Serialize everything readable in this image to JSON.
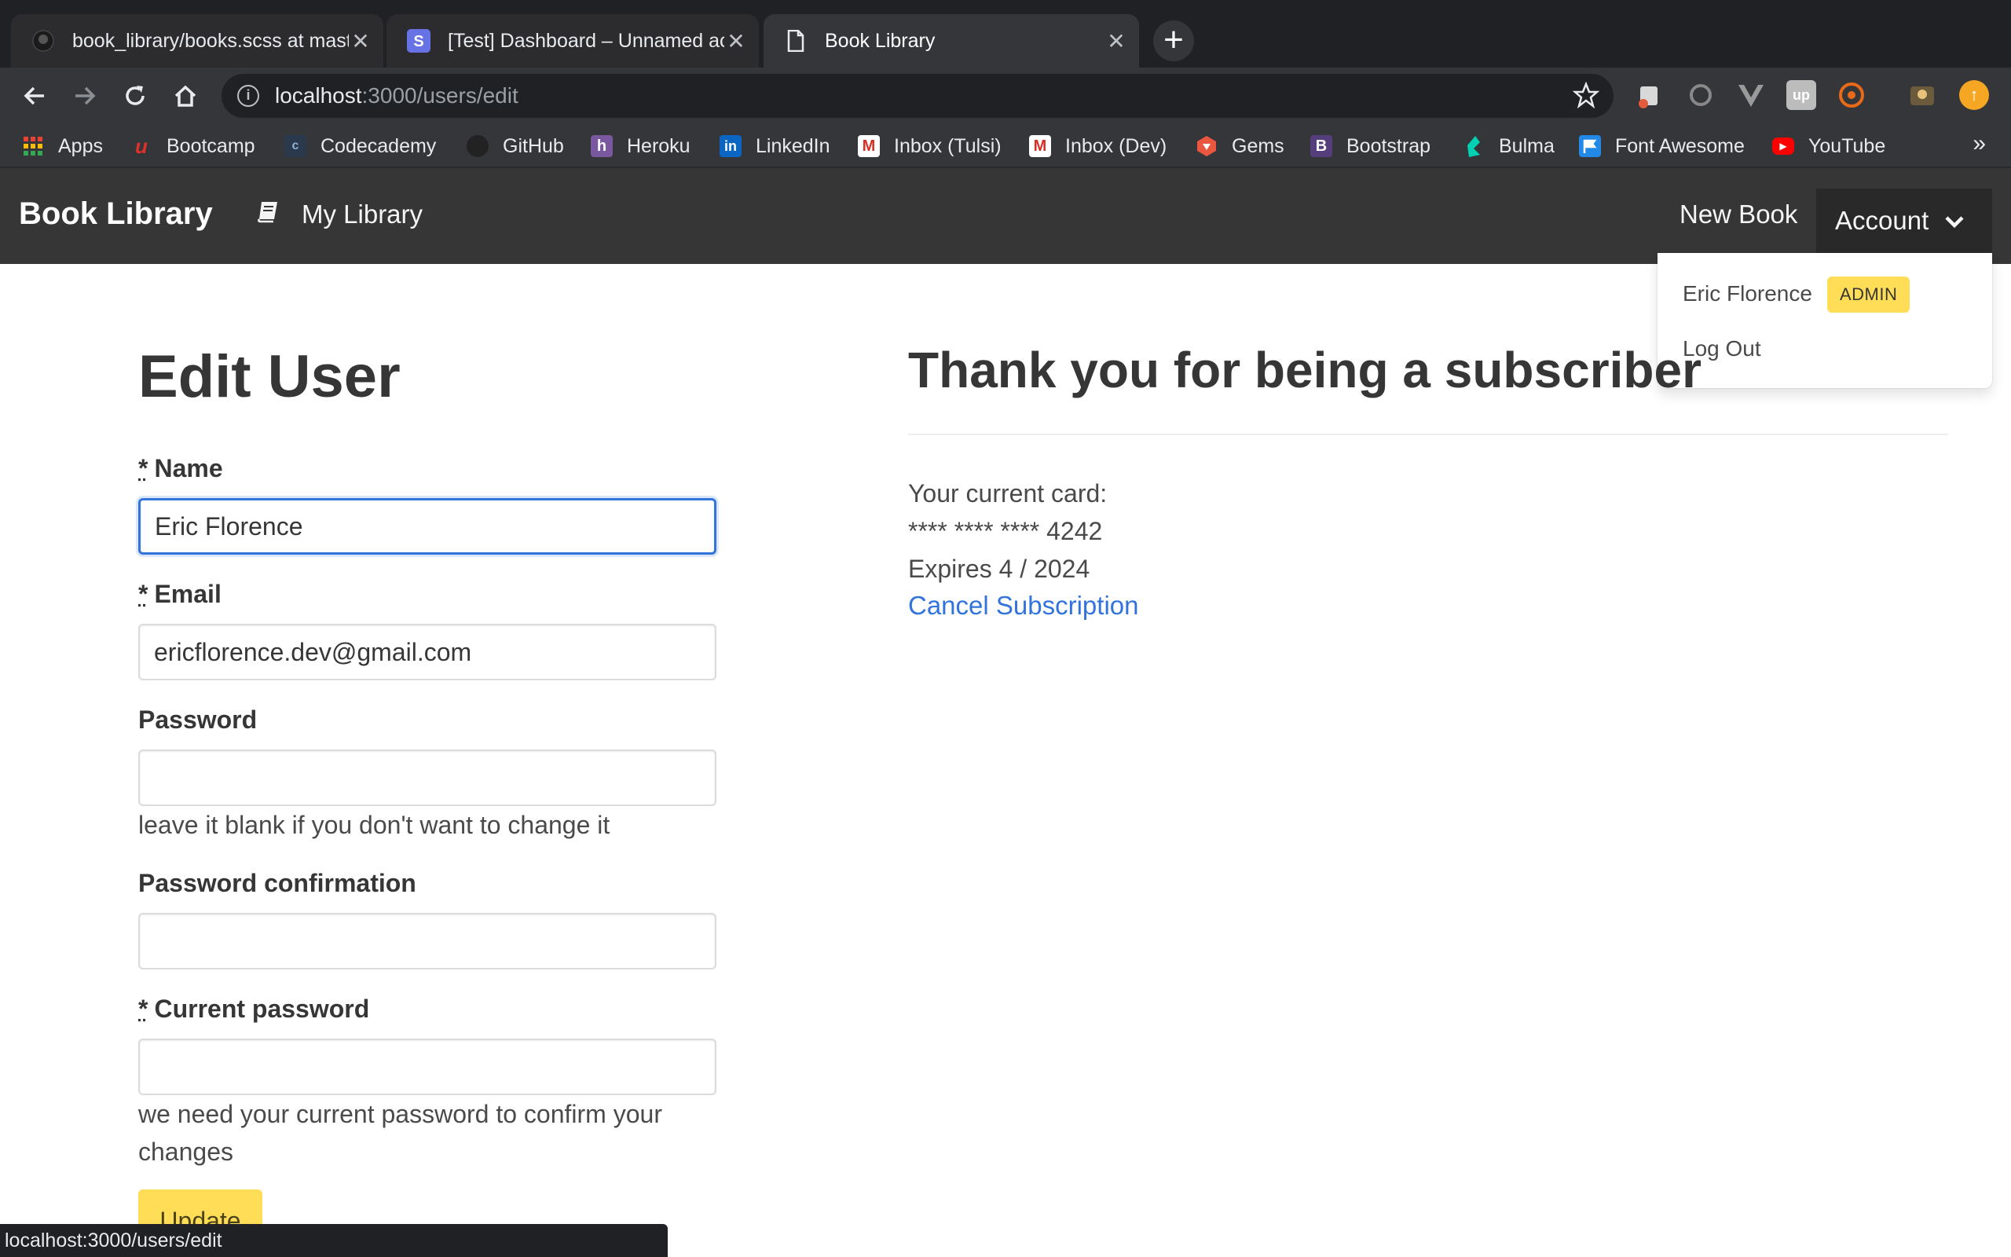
{
  "browser": {
    "tabs": [
      {
        "title": "book_library/books.scss at master · ericflorence/book_library",
        "favicon": "github-icon"
      },
      {
        "title": "[Test] Dashboard – Unnamed account",
        "favicon": "stripe-s-icon"
      },
      {
        "title": "Book Library",
        "favicon": "page-icon"
      }
    ],
    "url_host": "localhost",
    "url_path": ":3000/users/edit",
    "bookmarks": [
      "Apps",
      "Bootcamp",
      "Codecademy",
      "GitHub",
      "Heroku",
      "LinkedIn",
      "Inbox (Tulsi)",
      "Inbox (Dev)",
      "Gems",
      "Bootstrap",
      "Bulma",
      "Font Awesome",
      "YouTube"
    ],
    "bookmarks_more": "»",
    "status_url": "localhost:3000/users/edit"
  },
  "navbar": {
    "brand": "Book Library",
    "my_library": "My Library",
    "new_book": "New Book",
    "account": "Account"
  },
  "dropdown": {
    "user_name": "Eric Florence",
    "badge": "ADMIN",
    "logout": "Log Out"
  },
  "form": {
    "title": "Edit User",
    "required_mark": "*",
    "name_label": "Name",
    "name_value": "Eric Florence",
    "email_label": "Email",
    "email_value": "ericflorence.dev@gmail.com",
    "password_label": "Password",
    "password_help": "leave it blank if you don't want to change it",
    "password_confirmation_label": "Password confirmation",
    "current_password_label": "Current password",
    "current_password_help": "we need your current password to confirm your changes",
    "submit": "Update"
  },
  "subscription": {
    "title": "Thank you for being a subscriber",
    "card_label": "Your current card:",
    "card_number": "**** **** **** 4242",
    "expires": "Expires 4 / 2024",
    "cancel": "Cancel Subscription"
  },
  "colors": {
    "navbar": "#363636",
    "accent_yellow": "#ffdd57",
    "link_blue": "#3273dc"
  }
}
